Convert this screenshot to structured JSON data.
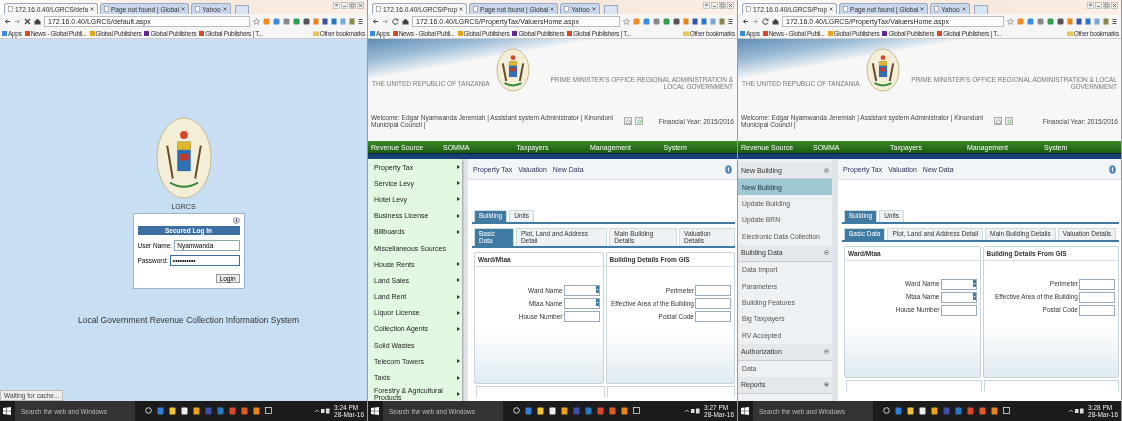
{
  "panes": [
    {
      "tabs": [
        {
          "label": "172.16.0.40/LGRCS/defa",
          "selected": true
        },
        {
          "label": "Page not found | Global",
          "selected": false
        },
        {
          "label": "Yahoo",
          "selected": false
        }
      ],
      "loading": true,
      "address": "172.16.0.40/LGRCS/default.aspx",
      "bookmarks": [
        "Apps",
        "News - Global Publi...",
        "Global Publishers",
        "Global Publishers",
        "Global Publishers | T..."
      ],
      "other_bookmarks": "Other bookmarks",
      "page": {
        "kind": "login",
        "app_name": "LGRCS",
        "box_title": "Secured Log In",
        "fields": [
          {
            "label": "User Name:",
            "value": "Nyamwanda"
          },
          {
            "label": "Password:",
            "value": "••••••••••"
          }
        ],
        "button": "Login",
        "footer": "Local Government Revenue Collection Information System"
      },
      "status": "Waiting for cache...",
      "taskbar": {
        "search": "Search the web and Windows",
        "time": "3:24 PM",
        "date": "28-Mar-16"
      }
    },
    {
      "tabs": [
        {
          "label": "172.16.0.40/LGRCS/Prop",
          "selected": true
        },
        {
          "label": "Page not found | Global",
          "selected": false
        },
        {
          "label": "Yahoo",
          "selected": false
        }
      ],
      "loading": false,
      "address": "172.16.0.40/LGRCS/PropertyTax/ValuersHome.aspx",
      "bookmarks": [
        "Apps",
        "News - Global Publi...",
        "Global Publishers",
        "Global Publishers",
        "Global Publishers | T..."
      ],
      "other_bookmarks": "Other bookmarks",
      "page": {
        "kind": "portal",
        "country": "THE UNITED REPUBLIC OF TANZANIA",
        "ministry": "PRIME MINISTER'S OFFICE REGIONAL ADMINISTRATION & LOCAL GOVERNMENT",
        "welcome": "Welcome: Edgar Nyamwanda Jeremiah | Assistant system Administrator | Kinondoni Municipal Council |",
        "financial_year": "Financial Year: 2015/2016",
        "nav": [
          "Revenue Source",
          "SOMMA",
          "Taxpayers",
          "Management",
          "System"
        ],
        "menu": [
          {
            "label": "Property Tax",
            "has_submenu": true
          },
          {
            "label": "Service Levy",
            "has_submenu": true
          },
          {
            "label": "Hotel Levy",
            "has_submenu": true
          },
          {
            "label": "Business License",
            "has_submenu": true
          },
          {
            "label": "Billboards",
            "has_submenu": true
          },
          {
            "label": "Miscellaneous Sources",
            "has_submenu": false
          },
          {
            "label": "House Rents",
            "has_submenu": true
          },
          {
            "label": "Land Sales",
            "has_submenu": true
          },
          {
            "label": "Land Rent",
            "has_submenu": true
          },
          {
            "label": "Liquor License",
            "has_submenu": true
          },
          {
            "label": "Collection Agents",
            "has_submenu": true
          },
          {
            "label": "Solid Wastes",
            "has_submenu": false
          },
          {
            "label": "Telecom Towers",
            "has_submenu": true
          },
          {
            "label": "Taxis",
            "has_submenu": true
          },
          {
            "label": "Forestry & Agricultural Products",
            "has_submenu": true
          }
        ],
        "breadcrumb": [
          "Property Tax",
          "Valuation",
          "New Data"
        ],
        "tabs": [
          {
            "label": "Building",
            "selected": true
          },
          {
            "label": "Units",
            "selected": false
          }
        ],
        "subtabs": [
          {
            "label": "Basic Data",
            "selected": true
          },
          {
            "label": "Plot, Land and Address Detail",
            "selected": false
          },
          {
            "label": "Main Building Details",
            "selected": false
          },
          {
            "label": "Valuation Details",
            "selected": false
          }
        ],
        "sections": [
          {
            "title": "Ward/Mtaa",
            "fields": [
              {
                "label": "Ward Name",
                "kind": "select"
              },
              {
                "label": "Mtaa Name",
                "kind": "select"
              },
              {
                "label": "House Number",
                "kind": "text"
              }
            ]
          },
          {
            "title": "Building Details From GIS",
            "fields": [
              {
                "label": "Perimeter",
                "kind": "text"
              },
              {
                "label": "Effective Area of the Building",
                "kind": "text"
              },
              {
                "label": "Postal Code",
                "kind": "text"
              }
            ]
          }
        ]
      },
      "taskbar": {
        "search": "Search the web and Windows",
        "time": "3:27 PM",
        "date": "28-Mar-16"
      }
    },
    {
      "tabs": [
        {
          "label": "172.16.0.40/LGRCS/Prop",
          "selected": true
        },
        {
          "label": "Page not found | Global",
          "selected": false
        },
        {
          "label": "Yahoo",
          "selected": false
        }
      ],
      "loading": false,
      "address": "172.16.0.40/LGRCS/PropertyTax/ValuersHome.aspx",
      "bookmarks": [
        "Apps",
        "News - Global Publi...",
        "Global Publishers",
        "Global Publishers",
        "Global Publishers | T..."
      ],
      "other_bookmarks": "Other bookmarks",
      "page": {
        "kind": "portal",
        "country": "THE UNITED REPUBLIC OF TANZANIA",
        "ministry": "PRIME MINISTER'S OFFICE REGIONAL ADMINISTRATION & LOCAL GOVERNMENT",
        "welcome": "Welcome: Edgar Nyamwanda Jeremiah | Assistant system Administrator | Kinondoni Municipal Council |",
        "financial_year": "Financial Year: 2015/2016",
        "nav": [
          "Revenue Source",
          "SOMMA",
          "Taxpayers",
          "Management",
          "System"
        ],
        "sidebar": [
          {
            "label": "New Building",
            "expanded": true,
            "children": [
              {
                "label": "New Building",
                "selected": true
              },
              {
                "label": "Update Building",
                "selected": false
              },
              {
                "label": "Update BRN",
                "selected": false
              },
              {
                "label": "Electronic Data Collection",
                "selected": false
              }
            ]
          },
          {
            "label": "Building Data",
            "expanded": true,
            "children": [
              {
                "label": "Data Import",
                "selected": false
              },
              {
                "label": "Parameters",
                "selected": false
              },
              {
                "label": "Building Features",
                "selected": false
              },
              {
                "label": "Big Taxpayers",
                "selected": false
              },
              {
                "label": "RV Accepted",
                "selected": false
              }
            ]
          },
          {
            "label": "Authorization",
            "expanded": true,
            "children": [
              {
                "label": "Data",
                "selected": false
              }
            ]
          },
          {
            "label": "Reports",
            "expanded": false
          }
        ],
        "breadcrumb": [
          "Property Tax",
          "Valuation",
          "New Data"
        ],
        "tabs": [
          {
            "label": "Building",
            "selected": true
          },
          {
            "label": "Units",
            "selected": false
          }
        ],
        "subtabs": [
          {
            "label": "Basic Data",
            "selected": true
          },
          {
            "label": "Plot, Land and Address Detail",
            "selected": false
          },
          {
            "label": "Main Building Details",
            "selected": false
          },
          {
            "label": "Valuation Details",
            "selected": false
          }
        ],
        "sections": [
          {
            "title": "Ward/Mtaa",
            "fields": [
              {
                "label": "Ward Name",
                "kind": "select"
              },
              {
                "label": "Mtaa Name",
                "kind": "select"
              },
              {
                "label": "House Number",
                "kind": "text"
              }
            ]
          },
          {
            "title": "Building Details From GIS",
            "fields": [
              {
                "label": "Perimeter",
                "kind": "text"
              },
              {
                "label": "Effective Area of the Building",
                "kind": "text"
              },
              {
                "label": "Postal Code",
                "kind": "text"
              }
            ]
          }
        ]
      },
      "taskbar": {
        "search": "Search the web and Windows",
        "time": "3:28 PM",
        "date": "28-Mar-16"
      }
    }
  ]
}
